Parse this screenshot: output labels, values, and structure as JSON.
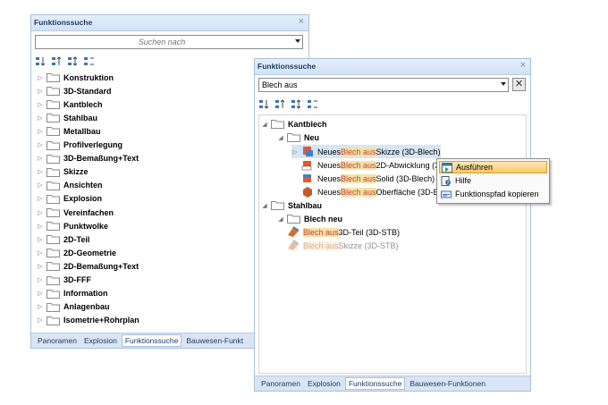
{
  "panel1": {
    "title": "Funktionssuche",
    "close": "×",
    "search_placeholder": "Suchen nach",
    "items": [
      "Konstruktion",
      "3D-Standard",
      "Kantblech",
      "Stahlbau",
      "Metallbau",
      "Profilverlegung",
      "3D-Bemaßung+Text",
      "Skizze",
      "Ansichten",
      "Explosion",
      "Vereinfachen",
      "Punktwolke",
      "2D-Teil",
      "2D-Geometrie",
      "2D-Bemaßung+Text",
      "3D-FFF",
      "Information",
      "Anlagenbau",
      "Isometrie+Rohrplan"
    ],
    "tabs": [
      "Panoramen",
      "Explosion",
      "Funktionssuche",
      "Bauwesen-Funkt"
    ],
    "active_tab": "Funktionssuche"
  },
  "panel2": {
    "title": "Funktionssuche",
    "close": "×",
    "search_value": "Blech aus",
    "clear": "✕",
    "tree": {
      "kantblech": "Kantblech",
      "neu": "Neu",
      "k1": {
        "pre": "Neues ",
        "hl": "Blech aus",
        "post": " Skizze (3D-Blech)"
      },
      "k2": {
        "pre": "Neues ",
        "hl": "Blech aus",
        "post": " 2D-Abwicklung (3"
      },
      "k3": {
        "pre": "Neues ",
        "hl": "Blech aus",
        "post": " Solid (3D-Blech)"
      },
      "k4": {
        "pre": "Neues ",
        "hl": "Blech aus",
        "post": " Oberfläche (3D-B"
      },
      "stahlbau": "Stahlbau",
      "blechneu": "Blech neu",
      "s1": {
        "hl": "Blech aus",
        "post": " 3D-Teil (3D-STB)"
      },
      "s2": {
        "hl": "Blech aus",
        "post": " Skizze (3D-STB)"
      }
    },
    "tabs": [
      "Panoramen",
      "Explosion",
      "Funktionssuche",
      "Bauwesen-Funktionen"
    ],
    "active_tab": "Funktionssuche"
  },
  "context_menu": {
    "items": [
      "Ausführen",
      "Hilfe",
      "Funktionspfad kopieren"
    ],
    "selected": "Ausführen"
  },
  "colors": {
    "highlight_bg": "#f6e2a5",
    "highlight_text": "#c1433a",
    "title_text": "#1f3d66"
  }
}
